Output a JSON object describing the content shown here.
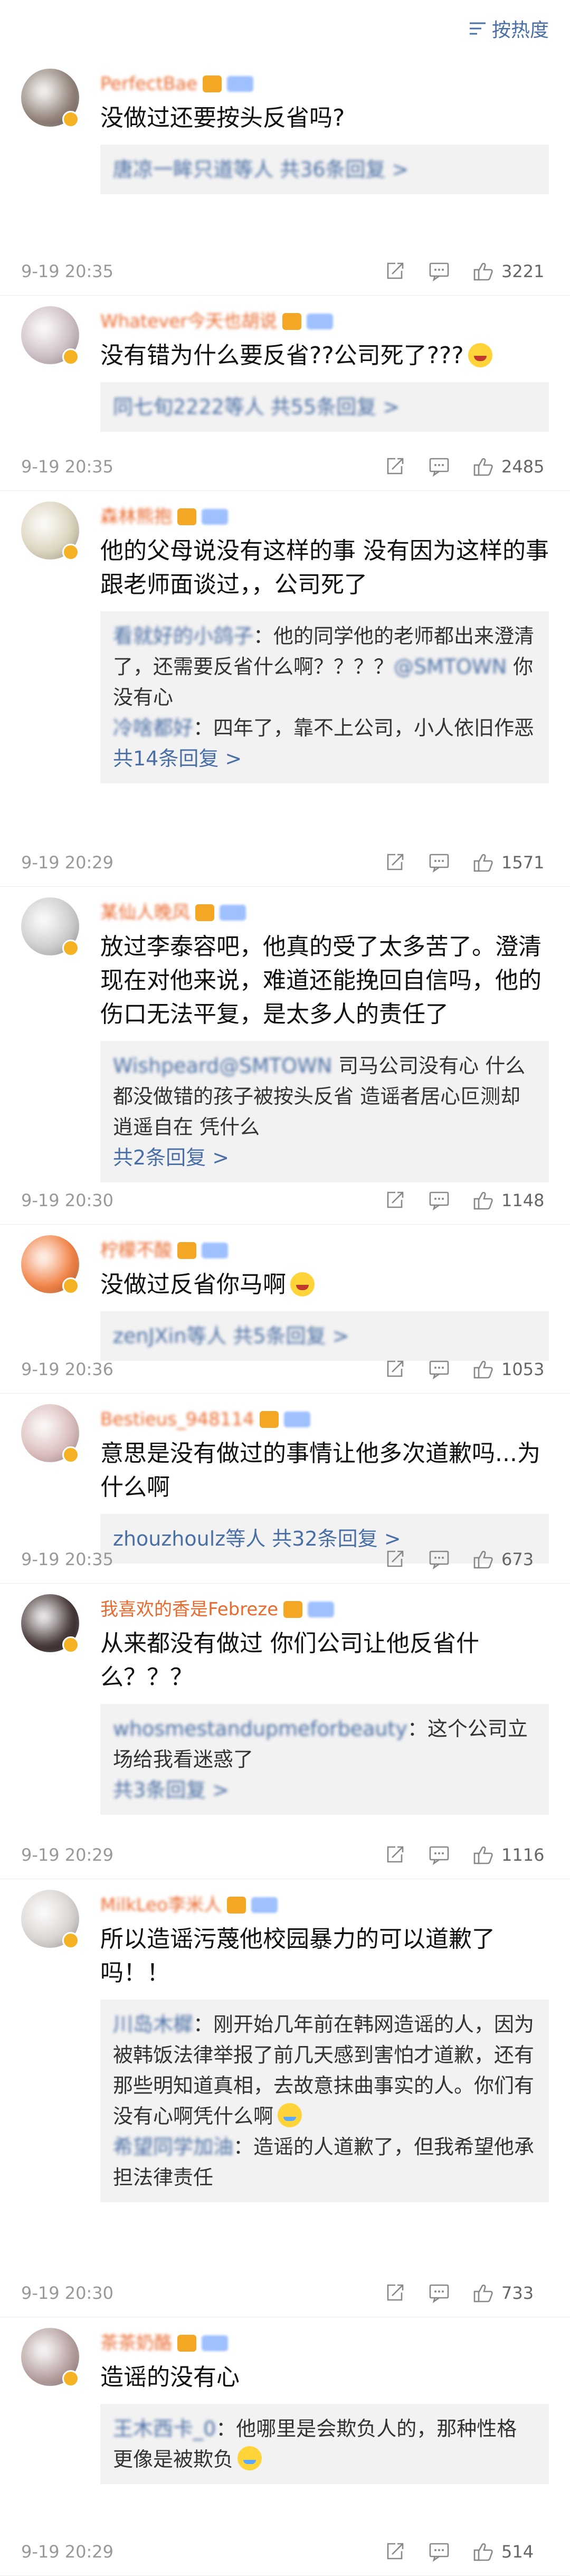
{
  "sort": {
    "label": "按热度",
    "icon": "sort-lines-icon"
  },
  "comments": [
    {
      "name": "PerfectBae",
      "text": "没做过还要按头反省吗?",
      "replies": [],
      "more": "唐凉一眸只道等人 共36条回复 >",
      "more_blur": true,
      "time": "9-19 20:35",
      "likes": "3221"
    },
    {
      "name": "Whatever今天也胡说",
      "text": "没有错为什么要反省??公司死了???",
      "emoji": true,
      "replies": [],
      "more": "同七旬2222等人 共55条回复 >",
      "more_blur": true,
      "time": "9-19 20:35",
      "likes": "2485"
    },
    {
      "name": "森林熊抱",
      "text": "他的父母说没有这样的事 没有因为这样的事跟老师面谈过，，公司死了",
      "replies": [
        {
          "who": "看就好的小鸽子",
          "text": "：他的同学他的老师都出来澄清了，还需要反省什么啊？？？？",
          "at": "@SMTOWN",
          "tail": " 你没有心"
        },
        {
          "who": "冷啥都好",
          "text": "：四年了，靠不上公司，小人依旧作恶"
        }
      ],
      "more": "共14条回复 >",
      "more_blur": false,
      "time": "9-19 20:29",
      "likes": "1571"
    },
    {
      "name": "某仙人晚风",
      "text": "放过李泰容吧，他真的受了太多苦了。澄清现在对他来说，难道还能挽回自信吗，他的伤口无法平复，是太多人的责任了",
      "replies": [
        {
          "who": "Wishpeard",
          "text": "",
          "at": "@SMTOWN",
          "tail": " 司马公司没有心 什么都没做错的孩子被按头反省 造谣者居心叵测却逍遥自在 凭什么"
        }
      ],
      "more": "共2条回复 >",
      "more_blur": false,
      "time": "9-19 20:30",
      "likes": "1148"
    },
    {
      "name": "柠檬不酸",
      "text": "没做过反省你马啊",
      "emoji": true,
      "replies": [],
      "more": "zenJXin等人 共5条回复 >",
      "more_blur": true,
      "time": "9-19 20:36",
      "likes": "1053"
    },
    {
      "name": "Bestieus_948114",
      "text": "意思是没有做过的事情让他多次道歉吗...为什么啊",
      "replies": [],
      "more": "zhouzhoulz等人 共32条回复 >",
      "more_blur": false,
      "time": "9-19 20:35",
      "likes": "673"
    },
    {
      "name": "我喜欢的香是Febreze",
      "name_clear": true,
      "text": "从来都没有做过 你们公司让他反省什么？？？",
      "replies": [
        {
          "who": "whosmestandupmeforbeauty",
          "text": "：这个公司立场给我看迷惑了"
        }
      ],
      "more": "共3条回复 >",
      "more_blur": true,
      "time": "9-19 20:29",
      "likes": "1116"
    },
    {
      "name": "MilkLeo李米人",
      "text": "所以造谣污蔑他校园暴力的可以道歉了吗！！",
      "replies": [
        {
          "who": "川岛木樨",
          "text": "：刚开始几年前在韩网造谣的人，因为被韩饭法律举报了前几天感到害怕才道歉，还有那些明知道真相，去故意抹曲事实的人。你们有没有心啊凭什么啊",
          "emoji": true
        },
        {
          "who": "希望同学加油",
          "text": "：造谣的人道歉了，但我希望他承担法律责任"
        }
      ],
      "more": "",
      "more_blur": false,
      "time": "9-19 20:30",
      "likes": "733"
    },
    {
      "name": "茶茶奶酪",
      "text": "造谣的没有心",
      "replies": [
        {
          "who": "王木西卡_0",
          "text": "：他哪里是会欺负人的，那种性格更像是被欺负",
          "emoji": true
        }
      ],
      "more": "",
      "more_blur": false,
      "time": "9-19 20:29",
      "likes": "514"
    }
  ]
}
